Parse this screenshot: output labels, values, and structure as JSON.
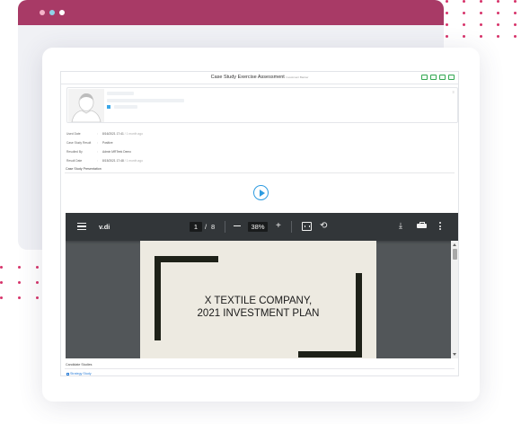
{
  "colors": {
    "accent": "#a83a66",
    "dot_accent": "#d7346b",
    "window_dot_1": "#f5b3c9",
    "window_dot_2": "#8fd3e8",
    "window_dot_3": "#ffffff",
    "play": "#2d9be0",
    "pdf_toolbar": "#323639",
    "pdf_page": "#edeae1"
  },
  "app": {
    "title": "Case Study Exercise Assessment",
    "subtitle": "Investment Banker",
    "header_tools": [
      "edit-icon",
      "pin-icon",
      "pencil-icon",
      "list-icon"
    ]
  },
  "profile": {
    "avatar_icon": "user-silhouette-icon",
    "indicator": "≡"
  },
  "details": [
    {
      "label": "Used Date",
      "value": "8/16/2021 17:41",
      "muted": "/ 1 month ago"
    },
    {
      "label": "Case Study Result",
      "value": "Positive",
      "muted": ""
    },
    {
      "label": "Resulted By",
      "value": "Admin MRTeek Demo",
      "muted": ""
    },
    {
      "label": "Result Date",
      "value": "8/15/2021 17:48",
      "muted": "/ 1 month ago"
    }
  ],
  "section_presentation": "Case Study Presentation",
  "section_candidate": "Candidate Studies",
  "candidate_link": "Strategy Study",
  "pdf": {
    "filename": "v.di",
    "current_page": "1",
    "separator": "/",
    "total_pages": "8",
    "zoom": "38%",
    "plus": "+",
    "rotate_glyph": "⟲",
    "download_glyph": "⤓",
    "heading_line1": "X TEXTILE COMPANY,",
    "heading_line2": "2021 INVESTMENT PLAN"
  }
}
